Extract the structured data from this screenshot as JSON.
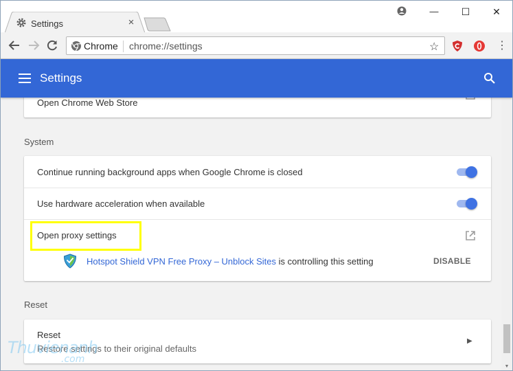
{
  "tab": {
    "title": "Settings",
    "close": "×",
    "icon": "gear-icon"
  },
  "window_controls": {
    "profile": "profile-icon",
    "minimize": "—",
    "maximize": "☐",
    "close": "✕"
  },
  "toolbar": {
    "back": "back-arrow-icon",
    "forward": "forward-arrow-icon",
    "reload": "reload-icon",
    "omnibox": {
      "chip": "Chrome",
      "url": "chrome://settings"
    },
    "star": "☆",
    "extensions": [
      "shield-extension-icon",
      "opera-extension-icon"
    ],
    "menu": "⋮"
  },
  "appbar": {
    "title": "Settings",
    "bg": "#3367d6"
  },
  "top_card": {
    "label": "Open Chrome Web Store"
  },
  "system": {
    "heading": "System",
    "rows": [
      {
        "label": "Continue running background apps when Google Chrome is closed",
        "enabled": true
      },
      {
        "label": "Use hardware acceleration when available",
        "enabled": true
      }
    ],
    "proxy": {
      "label": "Open proxy settings",
      "policy_ext_name": "Hotspot Shield VPN Free Proxy – Unblock Sites",
      "policy_suffix": " is controlling this setting",
      "disable_label": "DISABLE"
    }
  },
  "reset": {
    "heading": "Reset",
    "title": "Reset",
    "subtitle": "Restore settings to their original defaults",
    "chevron": "▶"
  },
  "watermark": {
    "main": "Thuvienanh",
    "sub": ".com"
  }
}
